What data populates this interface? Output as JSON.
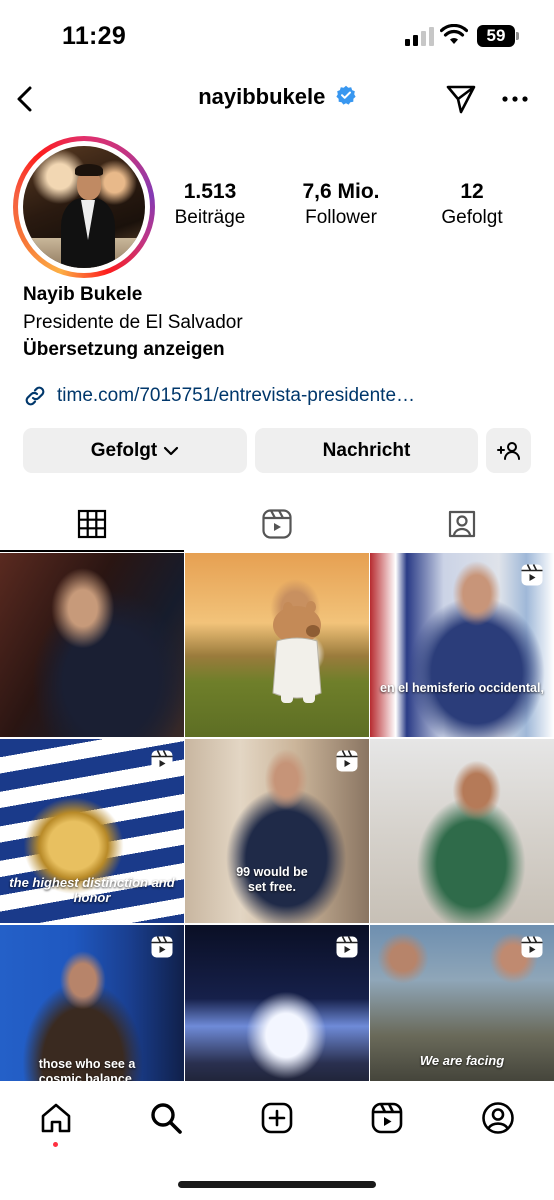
{
  "status_bar": {
    "time": "11:29",
    "battery": "59"
  },
  "header": {
    "username": "nayibbukele"
  },
  "profile": {
    "stats": [
      {
        "value": "1.513",
        "label": "Beiträge"
      },
      {
        "value": "7,6 Mio.",
        "label": "Follower"
      },
      {
        "value": "12",
        "label": "Gefolgt"
      }
    ],
    "name": "Nayib Bukele",
    "bio": "Presidente de El Salvador",
    "translate": "Übersetzung anzeigen",
    "link": "time.com/7015751/entrevista-presidente…"
  },
  "actions": {
    "following": "Gefolgt",
    "message": "Nachricht"
  },
  "grid": {
    "posts": [
      {
        "caption": "",
        "reel": false
      },
      {
        "caption": "",
        "reel": false
      },
      {
        "caption": "en el hemisferio occidental,",
        "reel": true
      },
      {
        "caption": "the highest distinction and honor",
        "reel": true
      },
      {
        "caption": "99 would be set free.",
        "reel": true
      },
      {
        "caption": "",
        "reel": false
      },
      {
        "caption": "those who see a cosmic balance.",
        "reel": true
      },
      {
        "caption": "",
        "reel": true
      },
      {
        "caption": "We are facing",
        "reel": true
      }
    ]
  },
  "colors": {
    "verified": "#3897f0",
    "link": "#00376b",
    "notification": "#ff3040"
  }
}
